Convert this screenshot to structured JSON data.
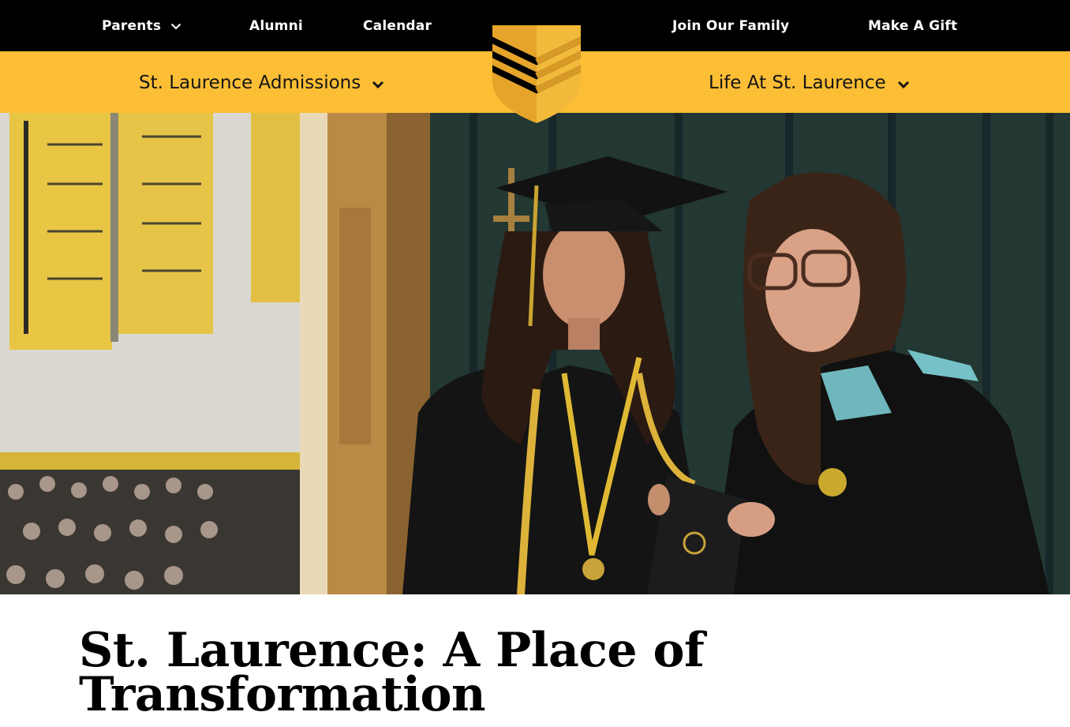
{
  "top_nav": {
    "items": [
      {
        "label": "Parents",
        "has_dropdown": true
      },
      {
        "label": "Alumni",
        "has_dropdown": false
      },
      {
        "label": "Calendar",
        "has_dropdown": false
      },
      {
        "label": "Join Our Family",
        "has_dropdown": false
      },
      {
        "label": "Make A Gift",
        "has_dropdown": false
      }
    ]
  },
  "main_nav": {
    "items": [
      {
        "label": "St. Laurence Admissions",
        "has_dropdown": true
      },
      {
        "label": "Life At St. Laurence",
        "has_dropdown": true
      }
    ]
  },
  "logo": {
    "icon": "shield-chevron-logo",
    "colors": [
      "#e9a52a",
      "#000000"
    ]
  },
  "hero": {
    "image": "graduate-receiving-diploma-photo"
  },
  "page": {
    "title": "St. Laurence: A Place of Transformation"
  },
  "colors": {
    "top_bar": "#000000",
    "main_bar": "#fbbe35",
    "brand_gold": "#e9a52a",
    "text_light": "#ffffff",
    "text_dark": "#151515"
  }
}
